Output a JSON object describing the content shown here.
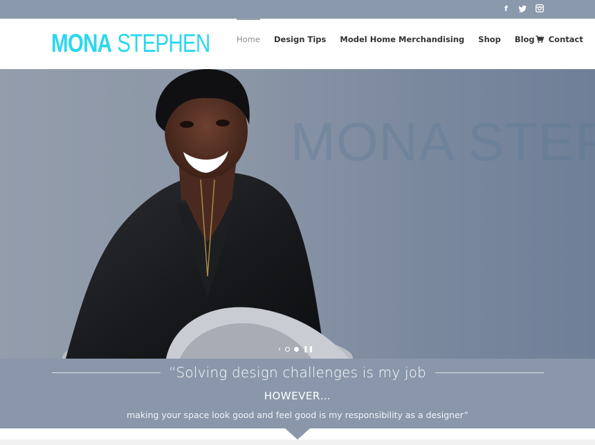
{
  "topbar": {
    "social": [
      {
        "icon": "facebook-icon",
        "glyph": "f"
      },
      {
        "icon": "twitter-icon",
        "glyph": "t"
      },
      {
        "icon": "instagram-icon",
        "glyph": "◙"
      }
    ]
  },
  "header": {
    "logo_first": "MONA",
    "logo_last": "STEPHEN",
    "nav": [
      "Home",
      "Design Tips",
      "Model Home Merchandising",
      "Shop",
      "Blog",
      "Contact"
    ],
    "active_nav": "Home",
    "cart_icon": "shopping-cart-icon"
  },
  "hero": {
    "watermark": "MONA STEPHEN",
    "slider": {
      "prev_icon": "chevron-right-icon",
      "dots": 2,
      "active_dot": 1,
      "pause_icon": "pause-icon"
    }
  },
  "tagline": {
    "quote": "“Solving design challenges is my job",
    "however": "HOWEVER…",
    "sub": "making your space look good and feel good is my responsibility as a designer”"
  },
  "colors": {
    "topbar": "#8a99ab",
    "logo": "#2ad8ec",
    "tagline_bg": "#8a97aa"
  }
}
